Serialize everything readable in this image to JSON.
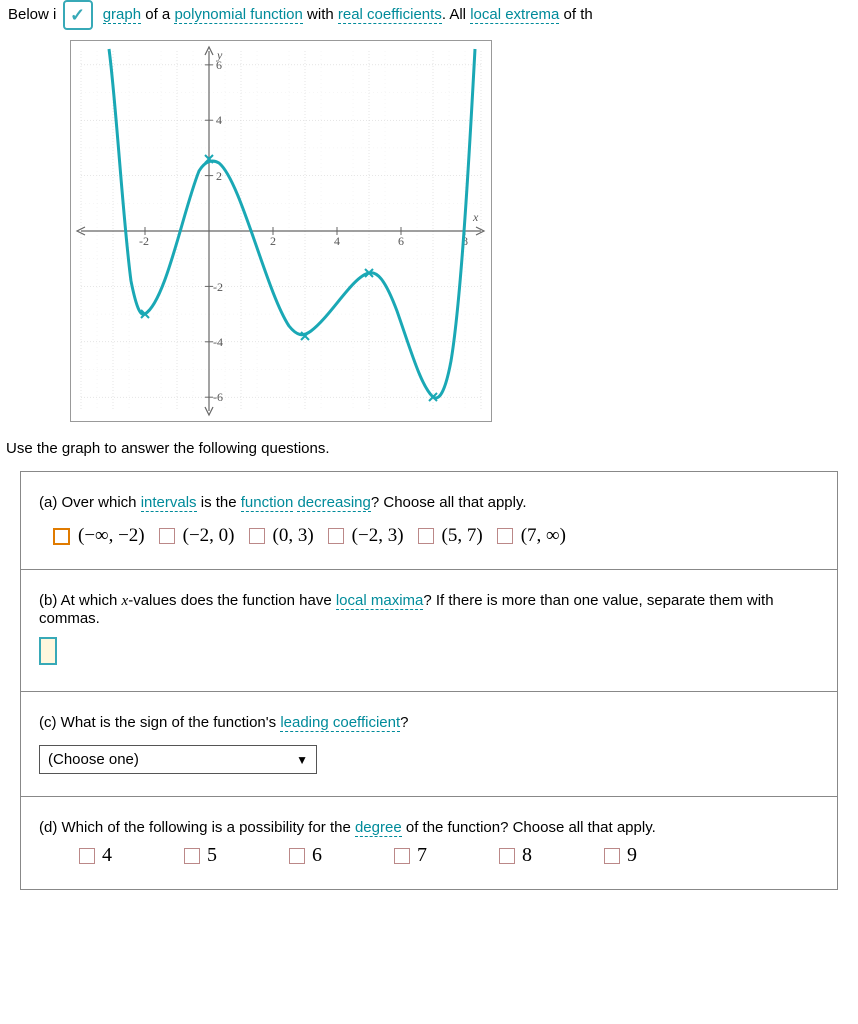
{
  "header": {
    "prefix": "Below i",
    "text_parts": [
      "graph",
      " of a ",
      "polynomial function",
      " with ",
      "real coefficients",
      ". All ",
      "local extrema",
      " of th"
    ]
  },
  "instruction": "Use the graph to answer the following questions.",
  "chart_data": {
    "type": "line",
    "xlabel": "x",
    "ylabel": "y",
    "xlim": [
      -4,
      8.5
    ],
    "ylim": [
      -6.5,
      6.5
    ],
    "x_ticks": [
      -2,
      2,
      4,
      6,
      8
    ],
    "y_ticks": [
      -6,
      -4,
      -2,
      2,
      4,
      6
    ],
    "extrema_points": [
      {
        "x": -2,
        "y": -3,
        "type": "min"
      },
      {
        "x": 0,
        "y": 2.6,
        "type": "max"
      },
      {
        "x": 3,
        "y": -3.8,
        "type": "min"
      },
      {
        "x": 5,
        "y": -1.5,
        "type": "max"
      },
      {
        "x": 7,
        "y": -6,
        "type": "min"
      }
    ],
    "end_behavior": {
      "left": "+inf",
      "right": "+inf"
    }
  },
  "parts": {
    "a": {
      "prompt_pre": "(a) Over which ",
      "term1": "intervals",
      "prompt_mid": " is the ",
      "term2": "function",
      "space": " ",
      "term3": "decreasing",
      "prompt_post": "? Choose all that apply.",
      "options": [
        "(−∞, −2)",
        "(−2, 0)",
        "(0, 3)",
        "(−2, 3)",
        "(5, 7)",
        "(7, ∞)"
      ],
      "selected_index": 0
    },
    "b": {
      "prompt_pre": "(b) At which ",
      "x_var": "x",
      "prompt_mid": "-values does the function have ",
      "term": "local maxima",
      "prompt_post": "? If there is more than one value, separate them with commas."
    },
    "c": {
      "prompt_pre": "(c) What is the sign of the function's ",
      "term": "leading coefficient",
      "prompt_post": "?",
      "dropdown_placeholder": "(Choose one)"
    },
    "d": {
      "prompt_pre": "(d) Which of the following is a possibility for the ",
      "term": "degree",
      "prompt_post": " of the function? Choose all that apply.",
      "options": [
        "4",
        "5",
        "6",
        "7",
        "8",
        "9"
      ]
    }
  }
}
